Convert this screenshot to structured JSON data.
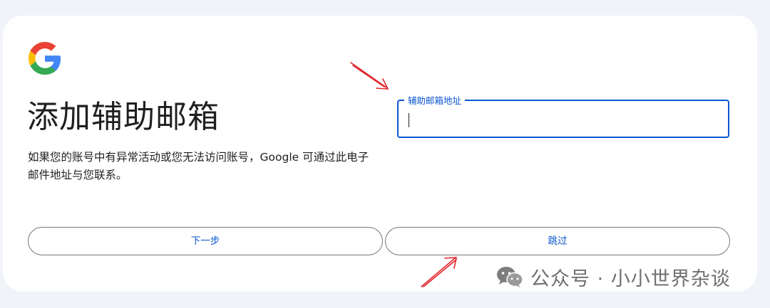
{
  "page": {
    "title": "添加辅助邮箱",
    "description": "如果您的账号中有异常活动或您无法访问账号，Google 可通过此电子邮件地址与您联系。",
    "logo_icon": "google-g-icon"
  },
  "form": {
    "recovery_email": {
      "label": "辅助邮箱地址",
      "value": ""
    }
  },
  "buttons": {
    "next_label": "下一步",
    "skip_label": "跳过"
  },
  "watermark": {
    "text": "公众号 · 小小世界杂谈",
    "icon": "wechat-icon"
  },
  "colors": {
    "accent": "#0b57d0",
    "annotation_arrow": "#e0232b",
    "background": "#f0f4f9",
    "card": "#ffffff"
  }
}
